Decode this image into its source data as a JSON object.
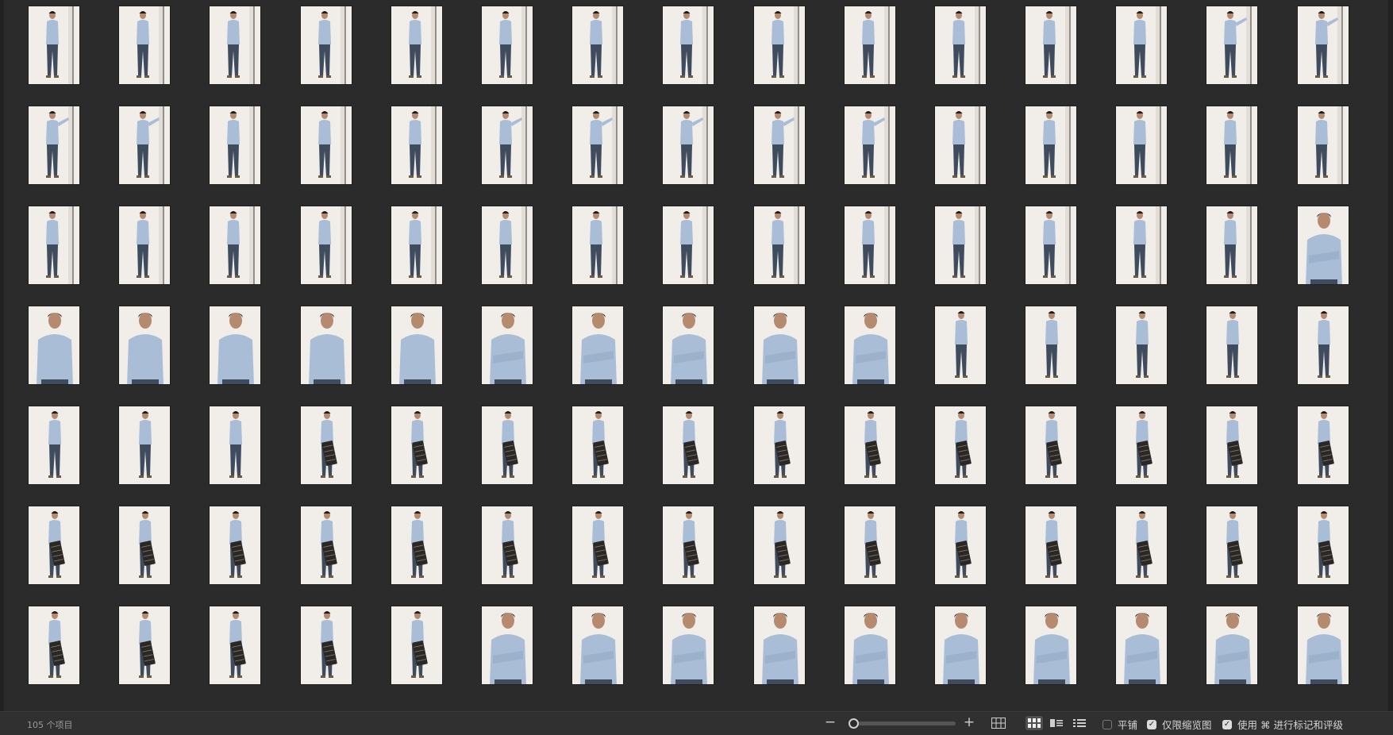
{
  "photos": {
    "columns": 15,
    "rows": [
      [
        "lean-wall-arms-crossed",
        "lean-wall-arms-crossed",
        "lean-wall-arms-crossed",
        "lean-wall-arms-crossed",
        "lean-wall-arms-crossed",
        "lean-wall-arms-crossed",
        "lean-wall-arms-crossed",
        "lean-wall-arms-crossed",
        "lean-wall-arms-crossed",
        "lean-wall-arms-crossed",
        "lean-wall-arms-crossed",
        "lean-wall-arms-crossed",
        "lean-wall-arms-crossed",
        "arm-raised-on-wall",
        "arm-raised-on-wall"
      ],
      [
        "arm-raised-on-wall",
        "arm-raised-on-wall",
        "lean-wall",
        "lean-wall",
        "lean-wall",
        "arm-raised-on-wall",
        "arm-raised-on-wall",
        "arm-raised-on-wall",
        "arm-raised-on-wall",
        "arm-raised-on-wall",
        "lean-wall",
        "lean-wall",
        "lean-wall",
        "lean-wall",
        "lean-wall"
      ],
      [
        "lean-wall",
        "lean-wall",
        "lean-wall",
        "lean-wall",
        "lean-wall",
        "lean-wall",
        "lean-wall",
        "lean-wall",
        "lean-wall",
        "lean-wall",
        "lean-wall",
        "lean-wall",
        "lean-wall",
        "lean-wall",
        "closeup-arms-crossed"
      ],
      [
        "closeup-standing",
        "closeup-standing",
        "closeup-standing",
        "closeup-standing",
        "closeup-standing",
        "closeup-arms-crossed",
        "closeup-arms-crossed",
        "closeup-arms-crossed",
        "closeup-arms-crossed",
        "closeup-arms-crossed",
        "full-standing",
        "full-standing",
        "full-standing",
        "full-standing",
        "full-standing"
      ],
      [
        "full-standing",
        "full-standing",
        "full-standing",
        "holding-grid",
        "holding-grid",
        "holding-grid",
        "holding-grid",
        "holding-grid",
        "holding-grid",
        "holding-grid",
        "holding-grid",
        "holding-grid",
        "holding-grid",
        "holding-grid",
        "holding-grid"
      ],
      [
        "holding-grid",
        "holding-grid",
        "holding-grid",
        "holding-grid",
        "holding-grid",
        "holding-grid",
        "holding-grid",
        "holding-grid",
        "holding-grid",
        "holding-grid",
        "holding-grid",
        "holding-grid",
        "holding-grid",
        "holding-grid",
        "holding-grid"
      ],
      [
        "holding-grid",
        "holding-grid",
        "holding-grid",
        "holding-grid",
        "holding-grid",
        "closeup-arms-crossed",
        "closeup-arms-crossed",
        "closeup-arms-crossed",
        "closeup-arms-crossed",
        "closeup-arms-crossed",
        "closeup-arms-crossed",
        "closeup-arms-crossed",
        "closeup-arms-crossed",
        "closeup-arms-crossed",
        "closeup-arms-crossed"
      ]
    ]
  },
  "statusbar": {
    "item_count": "105 个项目",
    "zoom_minus": "−",
    "zoom_plus": "+",
    "zoom_level": 0.02,
    "view_mode": "grid",
    "tile_label": "平铺",
    "tile_checked": false,
    "thumbs_only_label": "仅限缩览图",
    "thumbs_only_checked": true,
    "shortcut_label": "使用 ⌘ 进行标记和评级",
    "shortcut_checked": true
  },
  "colors": {
    "background": "#2b2b2b",
    "statusbar": "#303030",
    "photo_backdrop": "#f1eeea",
    "shirt": "#a9bdd6",
    "jeans": "#3f4c5e",
    "hair": "#1e1a18",
    "skin": "#b58a6e",
    "prop": "#2a2724"
  }
}
